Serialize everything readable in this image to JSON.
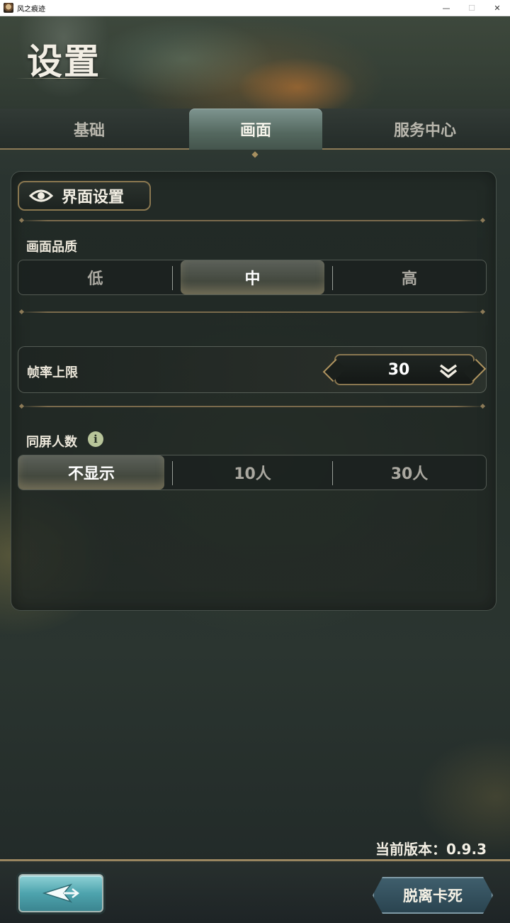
{
  "window": {
    "title": "风之痕迹",
    "minimize": "—",
    "maximize": "☐",
    "close": "✕"
  },
  "page": {
    "title": "设置"
  },
  "tabs": [
    {
      "label": "基础",
      "active": false
    },
    {
      "label": "画面",
      "active": true
    },
    {
      "label": "服务中心",
      "active": false
    }
  ],
  "section": {
    "icon": "eye-icon",
    "title": "界面设置"
  },
  "quality": {
    "label": "画面品质",
    "options": [
      "低",
      "中",
      "高"
    ],
    "selected": "中"
  },
  "framerate": {
    "label": "帧率上限",
    "value": "30",
    "icon": "chevron-down-icon"
  },
  "players_on_screen": {
    "label": "同屏人数",
    "info_icon": "i",
    "options": [
      "不显示",
      "10人",
      "30人"
    ],
    "selected": "不显示"
  },
  "footer": {
    "version": "当前版本：0.9.3",
    "back_icon": "back-arrow-icon",
    "unstuck_label": "脱离卡死"
  },
  "colors": {
    "accent_gold": "#8a7750",
    "active_tab": "#5f756d",
    "back_button": "#4ea4ae",
    "unstuck_button": "#2f4a56"
  }
}
